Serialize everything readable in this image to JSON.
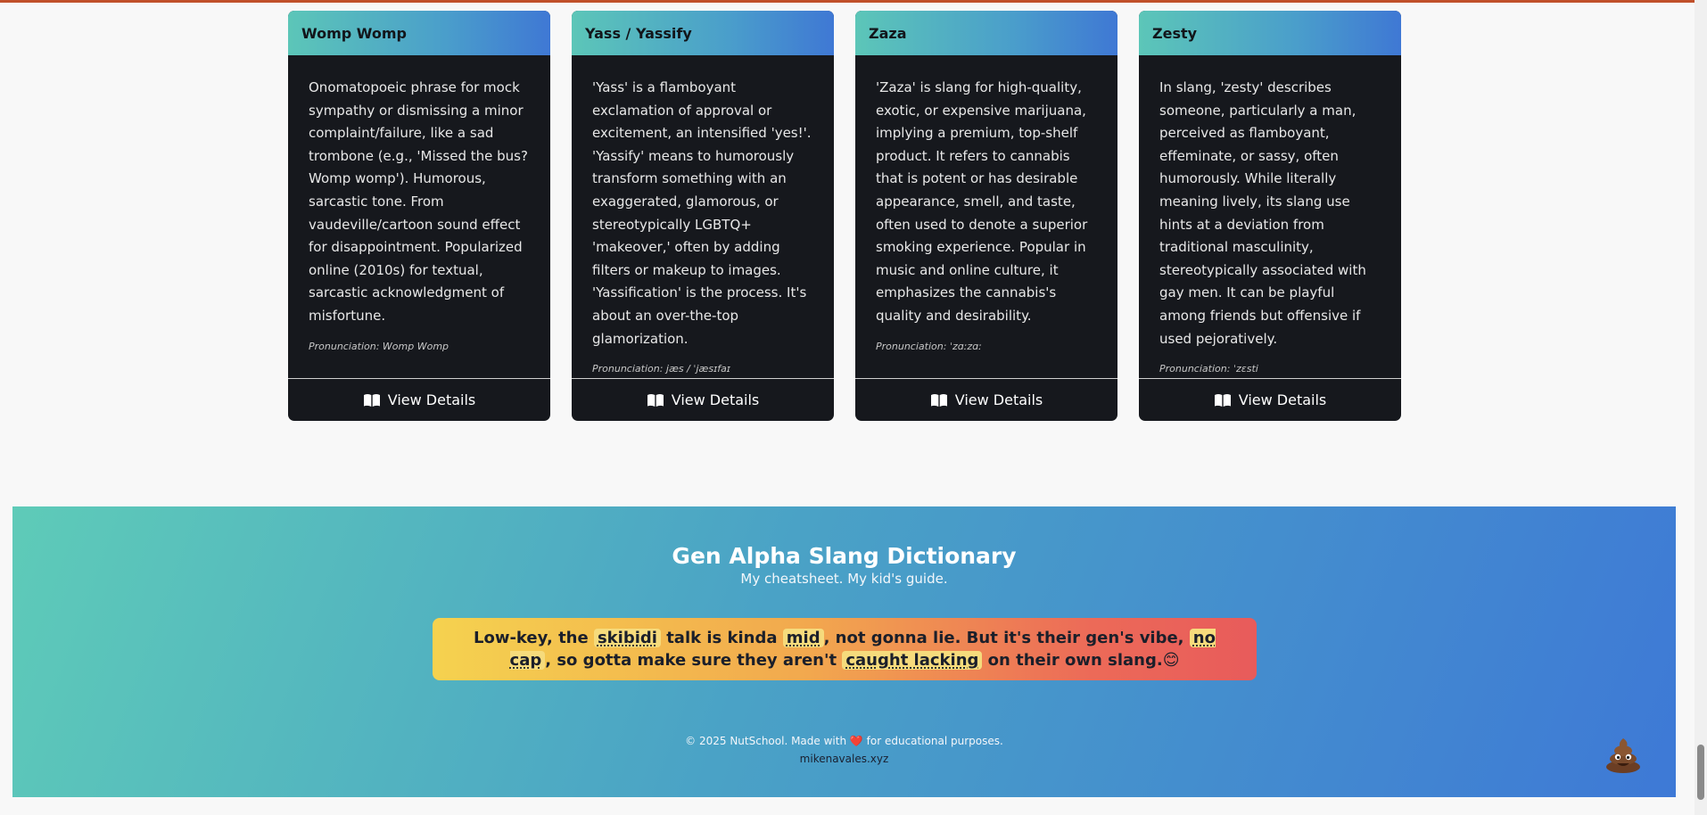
{
  "colors": {
    "card_bg": "#16181d",
    "accent_teal": "#5cc6b8",
    "accent_blue": "#3f78d4",
    "quote_yellow": "#f5d24f",
    "quote_red": "#e85b5b",
    "heart": "#e03a3a"
  },
  "cards": [
    {
      "title": "Womp Womp",
      "definition": "Onomatopoeic phrase for mock sympathy or dismissing a minor complaint/failure, like a sad trombone (e.g., 'Missed the bus? Womp womp'). Humorous, sarcastic tone. From vaudeville/cartoon sound effect for disappointment. Popularized online (2010s) for textual, sarcastic acknowledgment of misfortune.",
      "pronunciation": "Pronunciation: Womp Womp",
      "button": "View Details"
    },
    {
      "title": "Yass / Yassify",
      "definition": "'Yass' is a flamboyant exclamation of approval or excitement, an intensified 'yes!'. 'Yassify' means to humorously transform something with an exaggerated, glamorous, or stereotypically LGBTQ+ 'makeover,' often by adding filters or makeup to images. 'Yassification' is the process. It's about an over-the-top glamorization.",
      "pronunciation": "Pronunciation: jæs / ˈjæsɪfaɪ",
      "button": "View Details"
    },
    {
      "title": "Zaza",
      "definition": "'Zaza' is slang for high-quality, exotic, or expensive marijuana, implying a premium, top-shelf product. It refers to cannabis that is potent or has desirable appearance, smell, and taste, often used to denote a superior smoking experience. Popular in music and online culture, it emphasizes the cannabis's quality and desirability.",
      "pronunciation": "Pronunciation: ˈzɑːzɑː",
      "button": "View Details"
    },
    {
      "title": "Zesty",
      "definition": "In slang, 'zesty' describes someone, particularly a man, perceived as flamboyant, effeminate, or sassy, often humorously. While literally meaning lively, its slang use hints at a deviation from traditional masculinity, stereotypically associated with gay men. It can be playful among friends but offensive if used pejoratively.",
      "pronunciation": "Pronunciation: ˈzɛsti",
      "button": "View Details"
    }
  ],
  "footer": {
    "title": "Gen Alpha Slang Dictionary",
    "subtitle": "My cheatsheet. My kid's guide.",
    "quote": {
      "p1": "Low-key, the ",
      "w1": "skibidi",
      "p2": " talk is kinda ",
      "w2": "mid",
      "p3": ", not gonna lie. But it's their gen's vibe, ",
      "w3": "no cap",
      "p4": ", so gotta make sure they aren't ",
      "w4": "caught lacking",
      "p5": " on their own slang.😊"
    },
    "copyright_before": "© 2025 NutSchool. Made with ",
    "heart": "❤️",
    "copyright_after": " for educational purposes.",
    "site": "mikenavales.xyz"
  },
  "floating_button": {
    "emoji": "💩",
    "icon": "poop-icon"
  }
}
